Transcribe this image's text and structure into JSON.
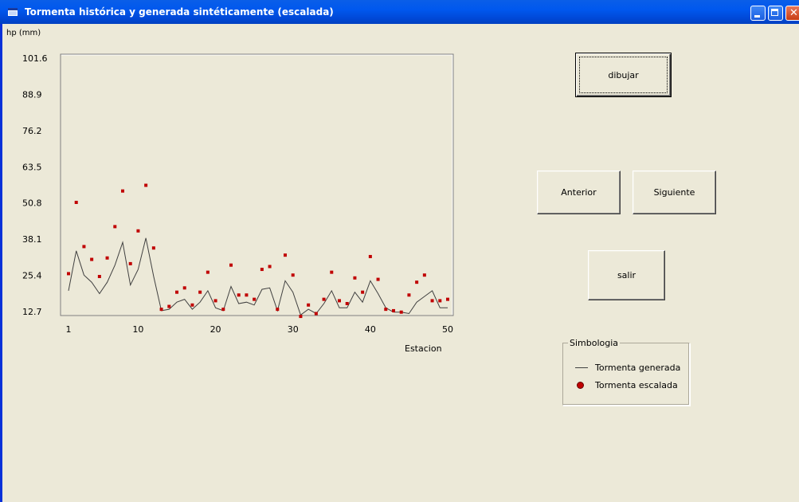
{
  "window": {
    "title": "Tormenta histórica y generada sintéticamente (escalada)",
    "icon": "app-window-icon",
    "controls": [
      "minimize-icon",
      "maximize-icon",
      "close-icon"
    ]
  },
  "buttons": {
    "draw": "dibujar",
    "previous": "Anterior",
    "next": "Siguiente",
    "exit": "salir"
  },
  "legend": {
    "title": "Simbologia",
    "generated": "Tormenta generada",
    "scaled": "Tormenta escalada"
  },
  "colors": {
    "title_bar": "#0058ee",
    "background": "#ece9d8",
    "generated_line": "#404040",
    "scaled_points": "#c00000"
  },
  "chart_data": {
    "type": "line+scatter",
    "xlabel": "Estacion",
    "ylabel": "hp (mm)",
    "xlim": [
      0,
      51
    ],
    "ylim": [
      12.7,
      101.6
    ],
    "xticks": [
      1,
      10,
      20,
      30,
      40,
      50
    ],
    "yticks": [
      12.7,
      25.4,
      38.1,
      50.8,
      63.5,
      76.2,
      88.9,
      101.6
    ],
    "series": [
      {
        "name": "Tormenta generada",
        "style": "line",
        "x": [
          1,
          2,
          3,
          4,
          5,
          6,
          7,
          8,
          9,
          10,
          11,
          12,
          13,
          14,
          15,
          16,
          17,
          18,
          19,
          20,
          21,
          22,
          23,
          24,
          25,
          26,
          27,
          28,
          29,
          30,
          31,
          32,
          33,
          34,
          35,
          36,
          37,
          38,
          39,
          40,
          41,
          42,
          43,
          44,
          45,
          46,
          47,
          48,
          49,
          50
        ],
        "y": [
          20,
          34,
          25.5,
          23,
          19,
          23,
          29,
          37,
          22,
          27.5,
          38.5,
          25,
          13,
          13.5,
          16,
          17,
          13.5,
          16,
          20,
          14,
          13,
          21.5,
          15.5,
          16,
          15,
          20.5,
          21,
          13,
          23.5,
          19.5,
          11.5,
          13.5,
          12,
          15.5,
          20,
          14,
          14,
          19.5,
          16,
          23.5,
          19,
          14,
          12.5,
          12.5,
          12,
          16,
          18,
          20,
          14,
          14
        ]
      },
      {
        "name": "Tormenta escalada",
        "style": "scatter",
        "x": [
          1,
          2,
          3,
          4,
          5,
          6,
          7,
          8,
          9,
          10,
          11,
          12,
          13,
          14,
          15,
          16,
          17,
          18,
          19,
          20,
          21,
          22,
          23,
          24,
          25,
          26,
          27,
          28,
          29,
          30,
          31,
          32,
          33,
          34,
          35,
          36,
          37,
          38,
          39,
          40,
          41,
          42,
          43,
          44,
          45,
          46,
          47,
          48,
          49,
          50
        ],
        "y": [
          26,
          51,
          35.5,
          31,
          25,
          31.5,
          42.5,
          55,
          29.5,
          41,
          57,
          35,
          13.5,
          14.5,
          19.5,
          21,
          15,
          19.5,
          26.5,
          16.5,
          13.5,
          29,
          18.5,
          18.5,
          17,
          27.5,
          28.5,
          13.5,
          32.5,
          25.5,
          11,
          15,
          12,
          17,
          26.5,
          16.5,
          15.5,
          24.5,
          19.5,
          32,
          24,
          13.5,
          13,
          12.5,
          18.5,
          23,
          25.5,
          16.5,
          16.5,
          17
        ]
      }
    ]
  }
}
